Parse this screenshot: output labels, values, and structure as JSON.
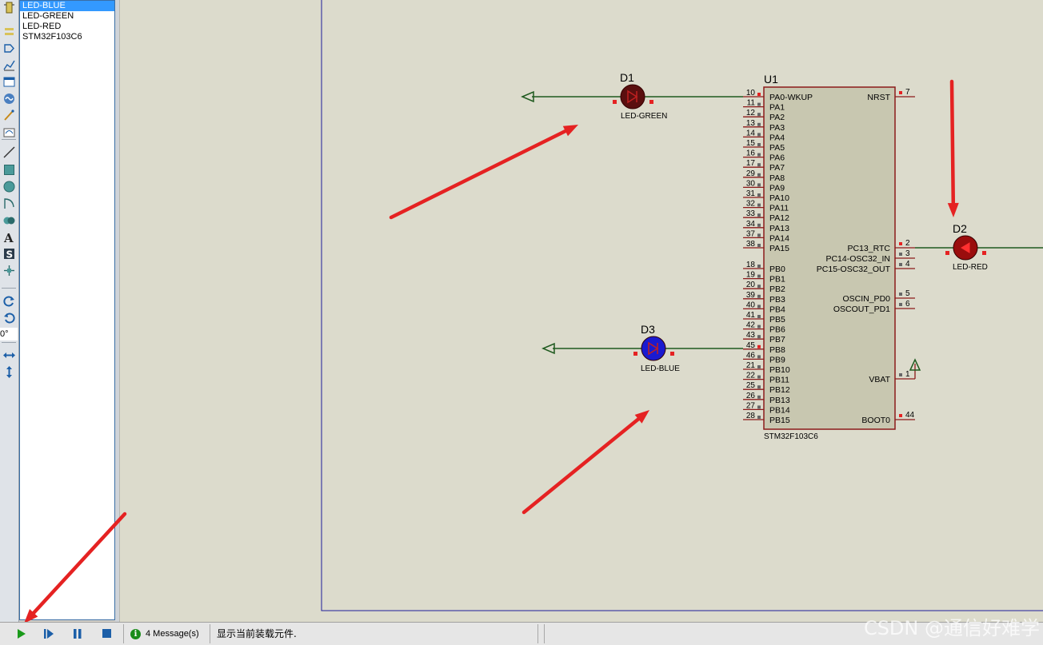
{
  "device_list": {
    "items": [
      "LED-BLUE",
      "LED-GREEN",
      "LED-RED",
      "STM32F103C6"
    ],
    "selected_index": 0
  },
  "toolbar": {
    "tools": [
      "component-mode-icon",
      "junction-icon",
      "wire-label-icon",
      "text-script-icon",
      "bus-icon",
      "subcircuit-icon",
      "terminals-icon",
      "device-pins-icon",
      "graph-icon",
      "tape-recorder-icon",
      "generator-icon",
      "voltage-probe-icon",
      "current-probe-icon",
      "virtual-instruments-icon",
      "line-icon",
      "box-icon",
      "circle-icon",
      "arc-icon",
      "path-icon",
      "text-icon",
      "symbol-icon",
      "marker-icon",
      "rotate-cw-icon",
      "rotate-ccw-icon",
      "mirror-x-icon",
      "mirror-y-icon"
    ],
    "angle": "0°"
  },
  "schematic": {
    "chip": {
      "ref": "U1",
      "part": "STM32F103C6",
      "left_pins": [
        {
          "num": "10",
          "name": "PA0-WKUP"
        },
        {
          "num": "11",
          "name": "PA1"
        },
        {
          "num": "12",
          "name": "PA2"
        },
        {
          "num": "13",
          "name": "PA3"
        },
        {
          "num": "14",
          "name": "PA4"
        },
        {
          "num": "15",
          "name": "PA5"
        },
        {
          "num": "16",
          "name": "PA6"
        },
        {
          "num": "17",
          "name": "PA7"
        },
        {
          "num": "29",
          "name": "PA8"
        },
        {
          "num": "30",
          "name": "PA9"
        },
        {
          "num": "31",
          "name": "PA10"
        },
        {
          "num": "32",
          "name": "PA11"
        },
        {
          "num": "33",
          "name": "PA12"
        },
        {
          "num": "34",
          "name": "PA13"
        },
        {
          "num": "37",
          "name": "PA14"
        },
        {
          "num": "38",
          "name": "PA15"
        },
        {
          "num": "18",
          "name": "PB0"
        },
        {
          "num": "19",
          "name": "PB1"
        },
        {
          "num": "20",
          "name": "PB2"
        },
        {
          "num": "39",
          "name": "PB3"
        },
        {
          "num": "40",
          "name": "PB4"
        },
        {
          "num": "41",
          "name": "PB5"
        },
        {
          "num": "42",
          "name": "PB6"
        },
        {
          "num": "43",
          "name": "PB7"
        },
        {
          "num": "45",
          "name": "PB8"
        },
        {
          "num": "46",
          "name": "PB9"
        },
        {
          "num": "21",
          "name": "PB10"
        },
        {
          "num": "22",
          "name": "PB11"
        },
        {
          "num": "25",
          "name": "PB12"
        },
        {
          "num": "26",
          "name": "PB13"
        },
        {
          "num": "27",
          "name": "PB14"
        },
        {
          "num": "28",
          "name": "PB15"
        }
      ],
      "right_pins": [
        {
          "num": "7",
          "name": "NRST"
        },
        {
          "num": "2",
          "name": "PC13_RTC"
        },
        {
          "num": "3",
          "name": "PC14-OSC32_IN"
        },
        {
          "num": "4",
          "name": "PC15-OSC32_OUT"
        },
        {
          "num": "5",
          "name": "OSCIN_PD0"
        },
        {
          "num": "6",
          "name": "OSCOUT_PD1"
        },
        {
          "num": "1",
          "name": "VBAT"
        },
        {
          "num": "44",
          "name": "BOOT0"
        }
      ]
    },
    "leds": [
      {
        "ref": "D1",
        "value": "LED-GREEN",
        "fill": "#5a0f0f",
        "arrow": "#c02020"
      },
      {
        "ref": "D2",
        "value": "LED-RED",
        "fill": "#9a0d0d",
        "arrow": "#ff3030"
      },
      {
        "ref": "D3",
        "value": "LED-BLUE",
        "fill": "#1a1ad0",
        "arrow": "#c02020"
      }
    ],
    "colors": {
      "wire": "#1f5a1f",
      "body": "#c8c7b0",
      "outline": "#8b1a1a",
      "annotation": "#e52222",
      "sheet_border": "#1e1e9a"
    }
  },
  "statusbar": {
    "buttons": [
      "play-icon",
      "step-icon",
      "pause-icon",
      "stop-icon"
    ],
    "messages": "4 Message(s)",
    "status_text": "显示当前装载元件."
  },
  "watermark": "CSDN @通信好难学"
}
